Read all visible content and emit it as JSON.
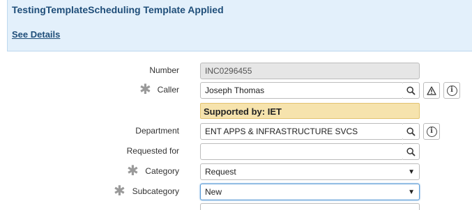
{
  "banner": {
    "title": "TestingTemplateScheduling Template Applied",
    "link": "See Details"
  },
  "form": {
    "number": {
      "label": "Number",
      "value": "INC0296455"
    },
    "caller": {
      "label": "Caller",
      "value": "Joseph Thomas"
    },
    "support": {
      "text": "Supported by: IET"
    },
    "department": {
      "label": "Department",
      "value": "ENT APPS & INFRASTRUCTURE SVCS"
    },
    "requested_for": {
      "label": "Requested for",
      "value": ""
    },
    "category": {
      "label": "Category",
      "value": "Request"
    },
    "subcategory": {
      "label": "Subcategory",
      "value": "New"
    }
  },
  "icons": {
    "search": "magnifier",
    "warning": "warning-triangle",
    "info": "info-circle",
    "select": "down-triangle"
  },
  "colors": {
    "banner_bg": "#e3f0fb",
    "banner_text": "#1f4e79",
    "support_bg": "#f6e3ad",
    "readonly_bg": "#e6e6e6",
    "focus_border": "#5b9bd5"
  }
}
